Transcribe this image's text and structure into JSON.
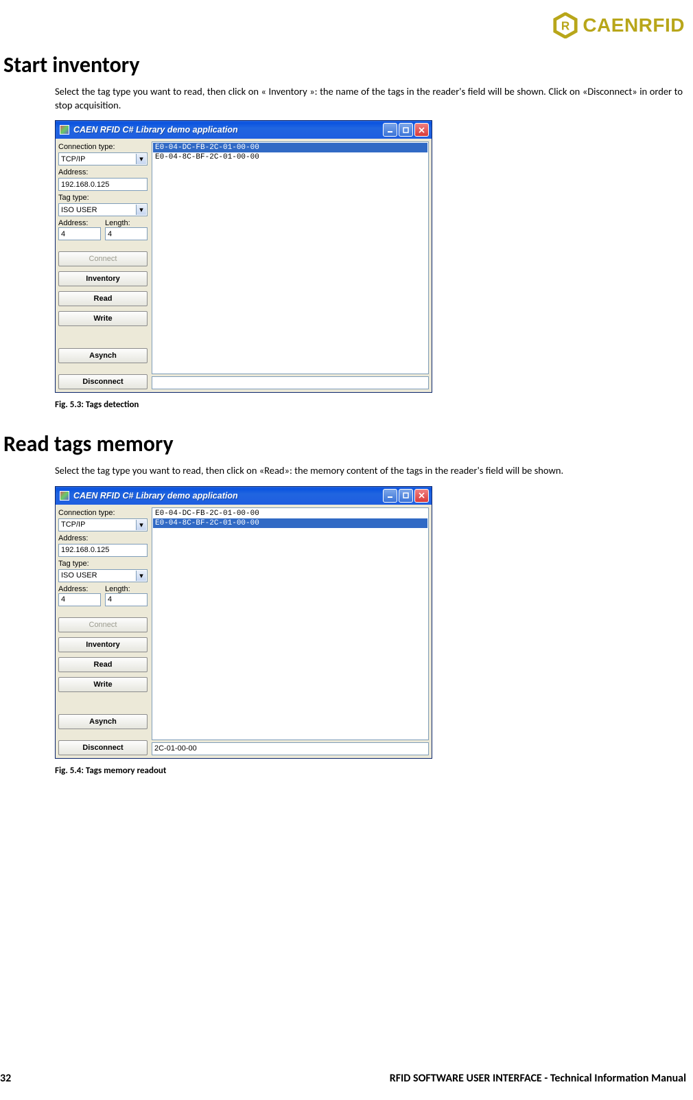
{
  "logo": {
    "brand": "CAENRFID"
  },
  "section1": {
    "heading": "Start inventory",
    "paragraph": "Select the tag type you want to read, then click on « Inventory »: the name of the tags in the reader's field will be shown. Click on «Disconnect» in order to stop acquisition.",
    "caption": "Fig. 5.3: Tags detection"
  },
  "section2": {
    "heading": "Read tags memory",
    "paragraph": "Select the tag type you want to read, then click on «Read»: the memory content of the tags in the reader's field will be shown.",
    "caption": "Fig. 5.4: Tags memory readout"
  },
  "app": {
    "title": "CAEN RFID C# Library demo application",
    "labels": {
      "conn_type": "Connection type:",
      "address": "Address:",
      "tag_type": "Tag type:",
      "addr2": "Address:",
      "length": "Length:"
    },
    "values": {
      "conn_type": "TCP/IP",
      "address": "192.168.0.125",
      "tag_type": "ISO USER",
      "addr2": "4",
      "length": "4"
    },
    "buttons": {
      "connect": "Connect",
      "inventory": "Inventory",
      "read": "Read",
      "write": "Write",
      "asynch": "Asynch",
      "disconnect": "Disconnect"
    },
    "tags": {
      "t0": "E0-04-DC-FB-2C-01-00-00",
      "t1": "E0-04-8C-BF-2C-01-00-00"
    },
    "status_fig4": "2C-01-00-00"
  },
  "footer": {
    "page": "32",
    "title": "RFID SOFTWARE USER INTERFACE - Technical Information Manual"
  }
}
